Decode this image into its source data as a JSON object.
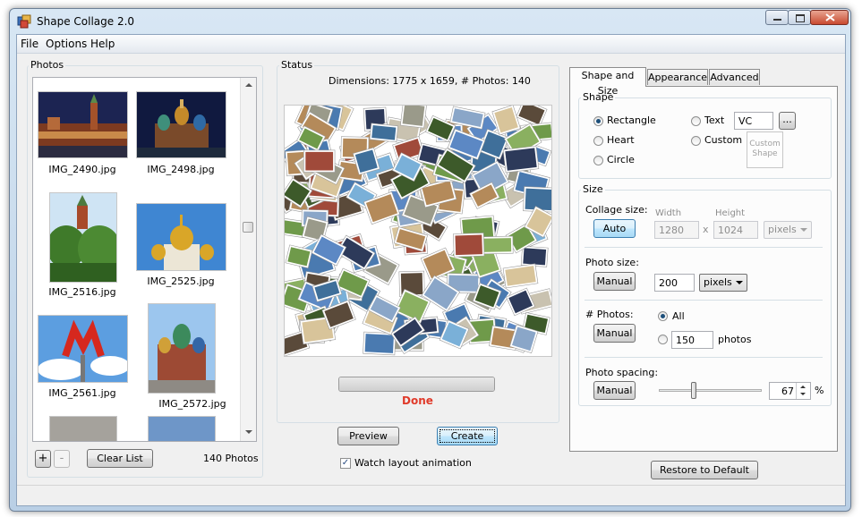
{
  "window": {
    "title": "Shape Collage 2.0"
  },
  "menu": [
    "File",
    "Options",
    "Help"
  ],
  "photos_panel": {
    "label": "Photos",
    "items": [
      "IMG_2490.jpg",
      "IMG_2498.jpg",
      "IMG_2516.jpg",
      "IMG_2525.jpg",
      "IMG_2561.jpg",
      "IMG_2572.jpg"
    ],
    "add_label": "+",
    "remove_label": "-",
    "clear_label": "Clear List",
    "count_text": "140 Photos"
  },
  "status_panel": {
    "label": "Status",
    "dimensions_text": "Dimensions: 1775 x 1659, # Photos: 140",
    "progress": 1.0,
    "done_text": "Done",
    "done_color": "#e03a2a"
  },
  "actions": {
    "preview_label": "Preview",
    "create_label": "Create",
    "watch_label": "Watch layout animation",
    "watch_checked": true
  },
  "tabs": [
    "Shape and Size",
    "Appearance",
    "Advanced"
  ],
  "active_tab": "Shape and Size",
  "shape": {
    "label": "Shape",
    "options": [
      "Rectangle",
      "Heart",
      "Circle",
      "Text",
      "Custom"
    ],
    "selected": "Rectangle",
    "text_value": "VC",
    "browse_label": "...",
    "custom_shape_label": "Custom Shape"
  },
  "size": {
    "label": "Size",
    "collage_size_label": "Collage size:",
    "auto_label": "Auto",
    "width_label": "Width",
    "height_label": "Height",
    "width_value": "1280",
    "x_label": "x",
    "height_value": "1024",
    "collage_unit": "pixels",
    "photo_size_label": "Photo size:",
    "photo_manual_label": "Manual",
    "photo_size_value": "200",
    "photo_unit": "pixels",
    "num_photos_label": "# Photos:",
    "num_manual_label": "Manual",
    "all_label": "All",
    "photos_value": "150",
    "photos_unit": "photos",
    "spacing_label": "Photo spacing:",
    "spacing_manual_label": "Manual",
    "spacing_value": "67",
    "spacing_unit": "%"
  },
  "restore_label": "Restore to Default",
  "colors": {
    "accent": "#3c7fb1",
    "done": "#e03a2a",
    "frame": "#b9cfe5"
  }
}
